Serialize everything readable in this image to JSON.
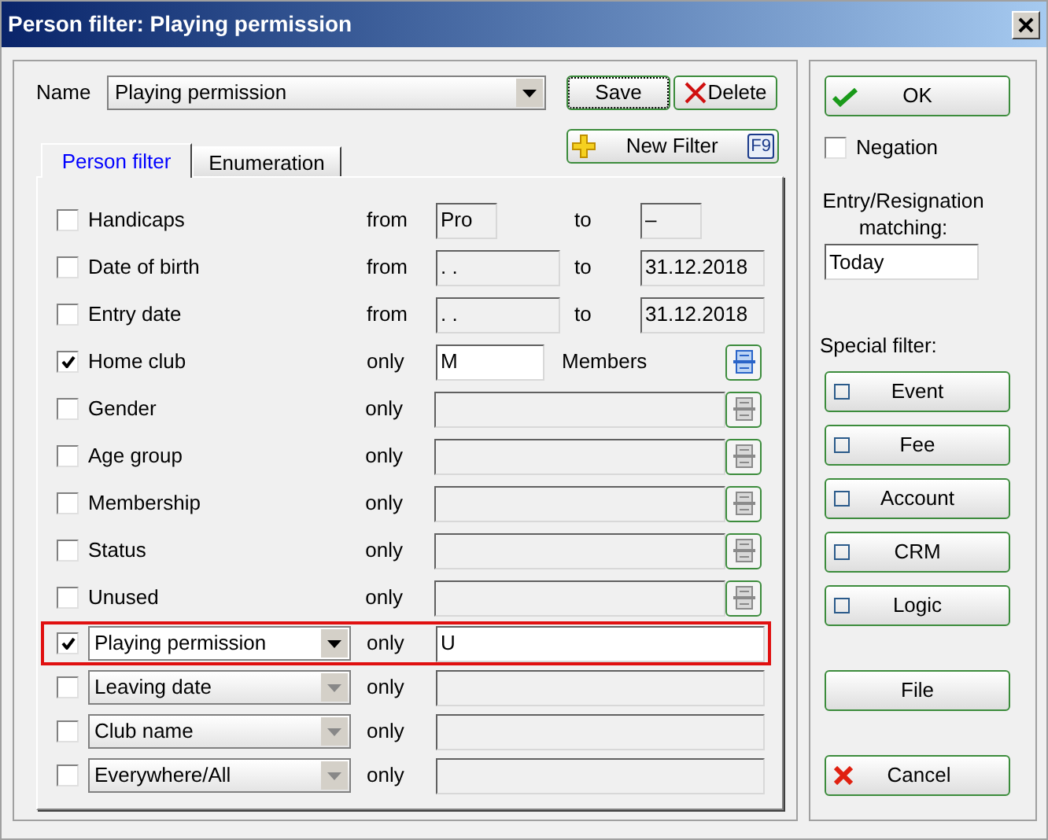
{
  "window": {
    "title": "Person filter: Playing permission"
  },
  "name_field": {
    "label": "Name",
    "value": "Playing permission"
  },
  "top_buttons": [
    {
      "kind": "save",
      "label": "Save"
    },
    {
      "kind": "delete",
      "label": "Delete"
    }
  ],
  "new_filter": {
    "label": "New Filter",
    "shortcut": "F9"
  },
  "tabs": [
    {
      "label": "Person filter",
      "selected": true
    },
    {
      "label": "Enumeration",
      "selected": false
    }
  ],
  "filters": [
    {
      "kind": "short_range",
      "label": "Handicaps",
      "checked": false,
      "operator": "from",
      "from": "Pro",
      "to_label": "to",
      "to": "–"
    },
    {
      "kind": "range",
      "label": "Date of birth",
      "checked": false,
      "operator": "from",
      "from": ". .",
      "to_label": "to",
      "to": "31.12.2018"
    },
    {
      "kind": "range",
      "label": "Entry date",
      "checked": false,
      "operator": "from",
      "from": ". .",
      "to_label": "to",
      "to": "31.12.2018"
    },
    {
      "kind": "lookup",
      "label": "Home club",
      "checked": true,
      "operator": "only",
      "value": "M",
      "suffix": "Members"
    },
    {
      "kind": "lookup",
      "label": "Gender",
      "checked": false,
      "operator": "only"
    },
    {
      "kind": "lookup",
      "label": "Age group",
      "checked": false,
      "operator": "only"
    },
    {
      "kind": "lookup",
      "label": "Membership",
      "checked": false,
      "operator": "only"
    },
    {
      "kind": "lookup",
      "label": "Status",
      "checked": false,
      "operator": "only"
    },
    {
      "kind": "lookup",
      "label": "Unused",
      "checked": false,
      "operator": "only"
    },
    {
      "kind": "combo",
      "label": "Playing permission",
      "checked": true,
      "operator": "only",
      "value": "U",
      "highlighted": true
    },
    {
      "kind": "combo",
      "label": "Leaving date",
      "checked": false,
      "operator": "only",
      "highlighted": false
    },
    {
      "kind": "combo",
      "label": "Club name",
      "checked": false,
      "operator": "only",
      "highlighted": false
    },
    {
      "kind": "combo",
      "label": "Everywhere/All",
      "checked": false,
      "operator": "only",
      "highlighted": false
    }
  ],
  "ok_button": "OK",
  "negation": {
    "label": "Negation",
    "checked": false
  },
  "matching": {
    "label": "Entry/Resignation matching:",
    "value": "Today"
  },
  "special_filter": {
    "label": "Special filter:",
    "buttons": [
      {
        "label": "Event",
        "checked": false
      },
      {
        "label": "Fee",
        "checked": false
      },
      {
        "label": "Account",
        "checked": false
      },
      {
        "label": "CRM",
        "checked": false
      },
      {
        "label": "Logic",
        "checked": false
      }
    ]
  },
  "file_button": "File",
  "cancel_button": "Cancel"
}
